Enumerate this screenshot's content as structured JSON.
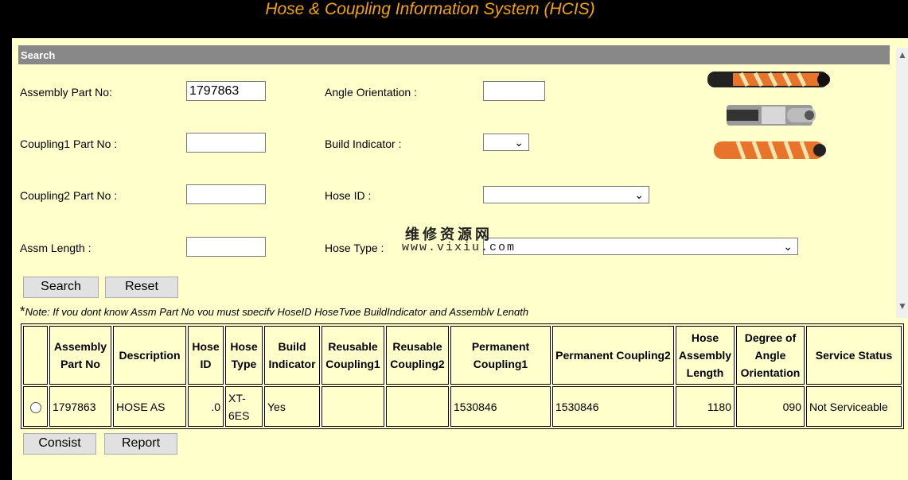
{
  "app_title": "Hose & Coupling Information System (HCIS)",
  "search": {
    "header": "Search",
    "assembly_part_no_label": "Assembly Part No:",
    "assembly_part_no_value": "1797863",
    "coupling1_label": "Coupling1 Part No :",
    "coupling1_value": "",
    "coupling2_label": "Coupling2 Part No :",
    "coupling2_value": "",
    "assm_length_label": "Assm Length :",
    "assm_length_value": "",
    "angle_orientation_label": "Angle Orientation :",
    "angle_orientation_value": "",
    "build_indicator_label": "Build Indicator :",
    "build_indicator_value": "",
    "hose_id_label": "Hose ID :",
    "hose_id_value": "",
    "hose_type_label": "Hose Type :",
    "hose_type_value": "",
    "search_button": "Search",
    "reset_button": "Reset",
    "note_star": "*",
    "note": "Note: If you dont know Assm Part No you must specify HoseID HoseType BuildIndicator and Assembly Length"
  },
  "watermark": {
    "line1": "维修资源网",
    "line2": "www.vixiu.com"
  },
  "table": {
    "headers": {
      "assembly_part_no": "Assembly Part No",
      "description": "Description",
      "hose_id": "Hose ID",
      "hose_type": "Hose Type",
      "build_indicator": "Build Indicator",
      "reusable_coupling1": "Reusable Coupling1",
      "reusable_coupling2": "Reusable Coupling2",
      "permanent_coupling1": "Permanent Coupling1",
      "permanent_coupling2": "Permanent Coupling2",
      "hose_assembly_length": "Hose Assembly Length",
      "degree_of_angle_orientation": "Degree of Angle Orientation",
      "service_status": "Service Status"
    },
    "rows": [
      {
        "assembly_part_no": "1797863",
        "description": "HOSE AS",
        "hose_id": ".0",
        "hose_type": "XT-6ES",
        "build_indicator": "Yes",
        "reusable_coupling1": "",
        "reusable_coupling2": "",
        "permanent_coupling1": "1530846",
        "permanent_coupling2": "1530846",
        "hose_assembly_length": "1180",
        "degree_of_angle_orientation": "090",
        "service_status": "Not Serviceable"
      }
    ]
  },
  "footer": {
    "consist_button": "Consist",
    "report_button": "Report"
  },
  "colors": {
    "title": "#f5a300",
    "background": "#ffffcc",
    "header_bar": "#888888"
  }
}
